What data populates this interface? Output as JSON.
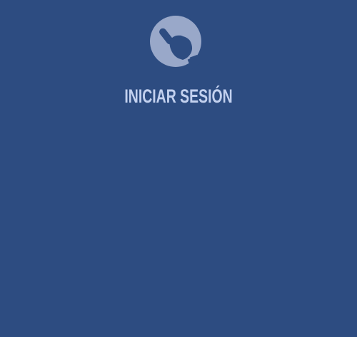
{
  "login": {
    "label": "INICIAR SESIÓN",
    "icon": "hand-pointer-icon"
  },
  "colors": {
    "background": "#2d4c81",
    "icon_circle": "#99a8c9",
    "icon_hand": "#2d4c81",
    "label": "#c3d1ef"
  }
}
